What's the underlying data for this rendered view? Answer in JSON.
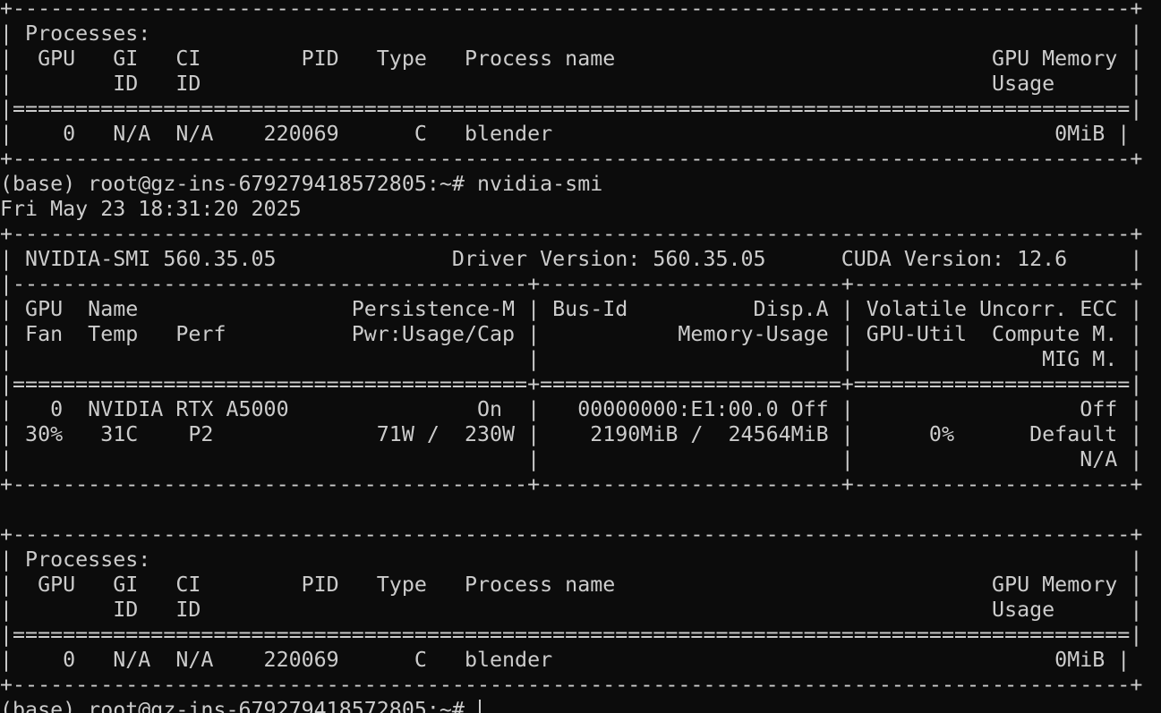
{
  "lines": [
    "+-----------------------------------------------------------------------------------------+",
    "| Processes:                                                                              |",
    "|  GPU   GI   CI        PID   Type   Process name                              GPU Memory |",
    "|        ID   ID                                                               Usage      |",
    "|=========================================================================================|",
    "|    0   N/A  N/A    220069      C   blender                                        0MiB |",
    "+-----------------------------------------------------------------------------------------+",
    "(base) root@gz-ins-679279418572805:~# nvidia-smi",
    "Fri May 23 18:31:20 2025",
    "+-----------------------------------------------------------------------------------------+",
    "| NVIDIA-SMI 560.35.05              Driver Version: 560.35.05      CUDA Version: 12.6     |",
    "|-----------------------------------------+------------------------+----------------------+",
    "| GPU  Name                 Persistence-M | Bus-Id          Disp.A | Volatile Uncorr. ECC |",
    "| Fan  Temp   Perf          Pwr:Usage/Cap |           Memory-Usage | GPU-Util  Compute M. |",
    "|                                         |                        |               MIG M. |",
    "|=========================================+========================+======================|",
    "|   0  NVIDIA RTX A5000               On  |   00000000:E1:00.0 Off |                  Off |",
    "| 30%   31C    P2             71W /  230W |    2190MiB /  24564MiB |      0%      Default |",
    "|                                         |                        |                  N/A |",
    "+-----------------------------------------+------------------------+----------------------+",
    "",
    "+-----------------------------------------------------------------------------------------+",
    "| Processes:                                                                              |",
    "|  GPU   GI   CI        PID   Type   Process name                              GPU Memory |",
    "|        ID   ID                                                               Usage      |",
    "|=========================================================================================|",
    "|    0   N/A  N/A    220069      C   blender                                        0MiB |",
    "+-----------------------------------------------------------------------------------------+"
  ],
  "prompt": "(base) root@gz-ins-679279418572805:~# "
}
